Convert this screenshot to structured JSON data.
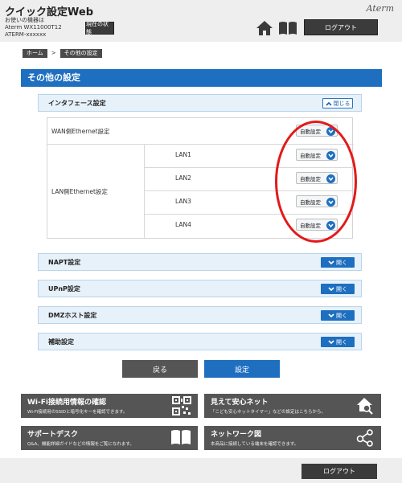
{
  "header": {
    "app_title": "クイック設定Web",
    "device_line1": "お使いの機器は",
    "device_line2": "Aterm WX11000T12",
    "device_line3": "ATERM-xxxxxx",
    "status_button": "現在の状態",
    "brand": "Aterm",
    "logout_label": "ログアウト"
  },
  "breadcrumb": {
    "home": "ホーム",
    "separator": ">",
    "current": "その他の設定"
  },
  "page_title": "その他の設定",
  "interface_section": {
    "title": "インタフェース設定",
    "close_label": "閉じる",
    "wan_label": "WAN側Ethernet設定",
    "wan_value": "自動設定",
    "lan_group_label": "LAN側Ethernet設定",
    "lan_ports": [
      {
        "label": "LAN1",
        "value": "自動設定"
      },
      {
        "label": "LAN2",
        "value": "自動設定"
      },
      {
        "label": "LAN3",
        "value": "自動設定"
      },
      {
        "label": "LAN4",
        "value": "自動設定"
      }
    ]
  },
  "collapsed_sections": [
    {
      "title": "NAPT設定",
      "open_label": "開く"
    },
    {
      "title": "UPnP設定",
      "open_label": "開く"
    },
    {
      "title": "DMZホスト設定",
      "open_label": "開く"
    },
    {
      "title": "補助設定",
      "open_label": "開く"
    }
  ],
  "actions": {
    "back": "戻る",
    "set": "設定"
  },
  "tiles": [
    {
      "title": "Wi-Fi接続用情報の確認",
      "subtitle": "Wi-Fi接続用のSSIDと暗号化キーを確認できます。",
      "icon": "qr-code-icon"
    },
    {
      "title": "見えて安心ネット",
      "subtitle": "「こども安心ネットタイマー」などの設定はこちらから。",
      "icon": "home-search-icon"
    },
    {
      "title": "サポートデスク",
      "subtitle": "Q&A、機能詳細ガイドなどの情報をご覧になれます。",
      "icon": "open-book-icon"
    },
    {
      "title": "ネットワーク図",
      "subtitle": "本商品に接続している端末を確認できます。",
      "icon": "network-icon"
    }
  ],
  "footer": {
    "logout_label": "ログアウト"
  },
  "colors": {
    "accent": "#1e6fc0",
    "dark_button": "#3b3b3b",
    "tile": "#555555",
    "highlight": "#e21a1a"
  }
}
